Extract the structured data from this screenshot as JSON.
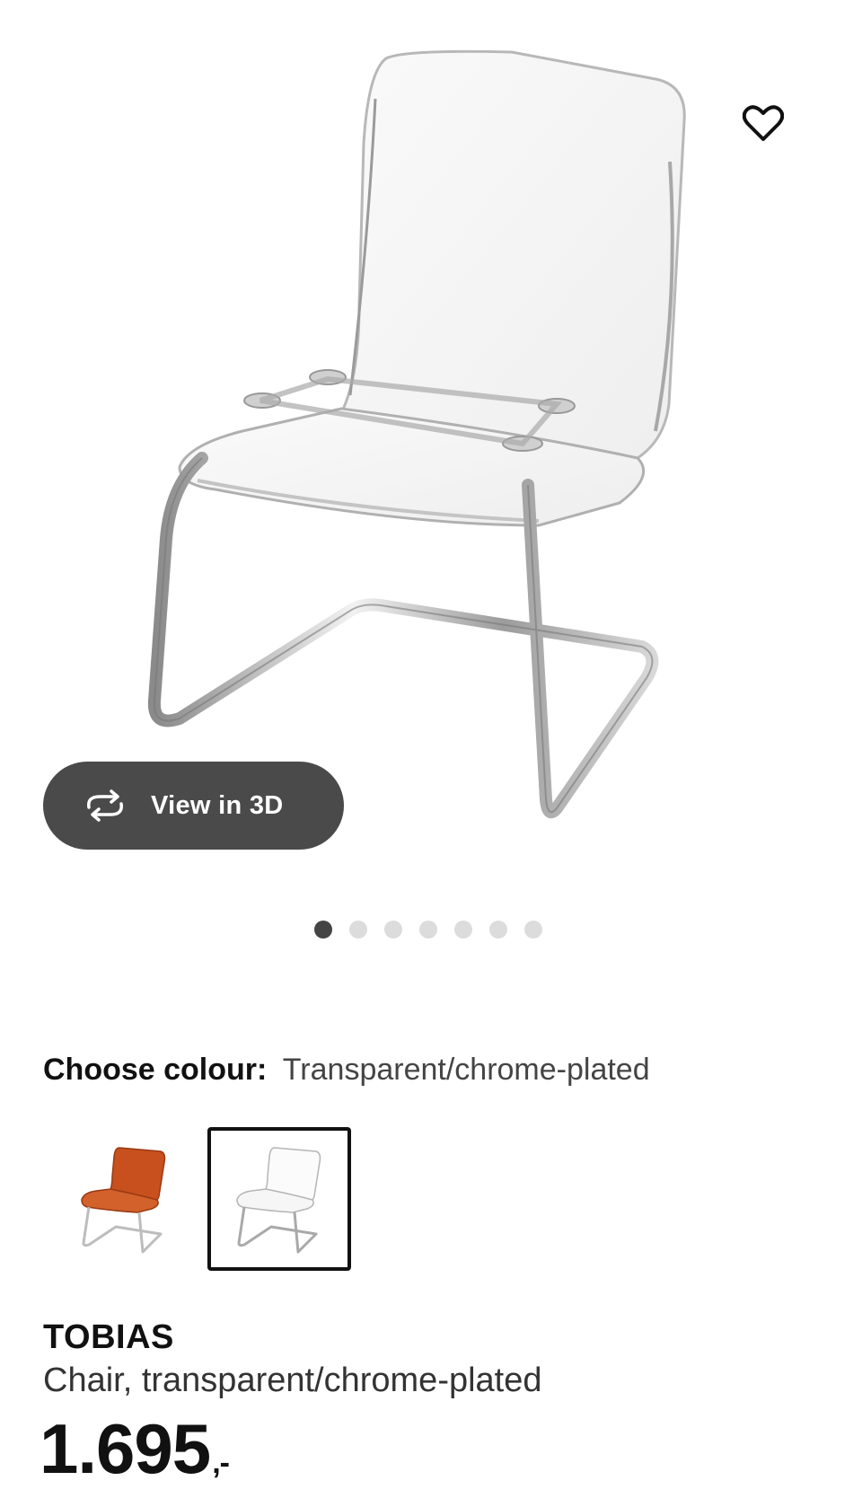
{
  "gallery": {
    "favourite_icon": "heart-outline-icon",
    "view_3d_icon": "rotate-arrows-icon",
    "view_3d_label": "View in 3D",
    "dot_count": 7,
    "active_dot": 1
  },
  "colour_chooser": {
    "label": "Choose colour:",
    "selected": "Transparent/chrome-plated",
    "options": [
      {
        "name": "orange/chrome-plated",
        "selected": false
      },
      {
        "name": "transparent/chrome-plated",
        "selected": true
      }
    ]
  },
  "product": {
    "name": "TOBIAS",
    "description": "Chair, transparent/chrome-plated",
    "price": "1.695",
    "price_suffix": ",-"
  },
  "colors": {
    "view_3d_bg": "#4a4a4a",
    "dot_active": "#444444",
    "dot_inactive": "#dcdcdc",
    "swatch_orange": "#c8501f"
  }
}
